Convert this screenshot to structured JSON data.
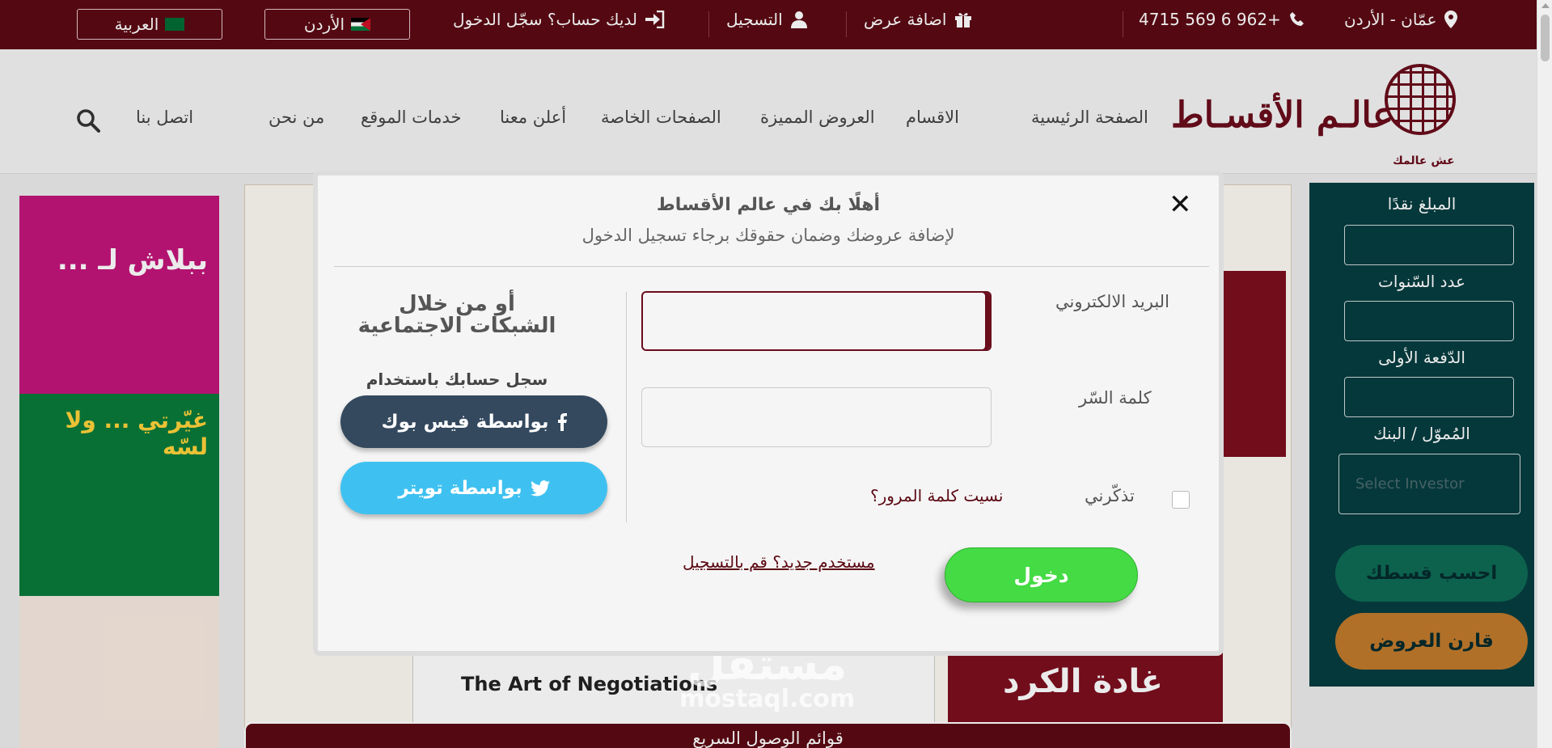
{
  "topbar": {
    "location": "عمّان - الأردن",
    "phone": "4715 569 6 962+",
    "add_offer": "اضافة عرض",
    "register": "التسجيل",
    "login_prompt": "لديك حساب؟ سجّل الدخول",
    "country": "الأردن",
    "language": "العربية"
  },
  "header": {
    "logo_text": "عالـم الأقسـاط",
    "logo_tagline": "عش عالمك",
    "nav": [
      "الصفحة الرئيسية",
      "الاقسام",
      "العروض المميزة",
      "الصفحات الخاصة",
      "أعلن معنا",
      "خدمات الموقع",
      "من نحن",
      "اتصل بنا"
    ]
  },
  "calculator": {
    "cash_amount": "المبلغ نقدًا",
    "years": "عدد السّنوات",
    "down_payment": "الدّفعة الأولى",
    "financier": "المُموّل / البنك",
    "select_placeholder": "Select Investor",
    "calc_button": "احسب قسطك",
    "compare_button": "قارن العروض"
  },
  "background": {
    "course_item": "The Art of Negotiations",
    "book_title": "غادة الكرد",
    "quick_links": "قوائم الوصول السريع",
    "ad1_text": "ببلاش لـ ...",
    "ad2_text": "غيّرتي ... ولا لسّه"
  },
  "modal": {
    "title": "أهلًا بك في عالم الأقساط",
    "subtitle": "لإضافة عروضك وضمان حقوقك برجاء تسجيل الدخول",
    "email_label": "البريد الالكتروني",
    "password_label": "كلمة السّر",
    "remember_label": "تذكّرني",
    "forgot_link": "نسيت كلمة المرور؟",
    "login_button": "دخول",
    "register_link": "مستخدم جديد؟ قم بالتسجيل",
    "social_title": "أو من خلال الشبكات الاجتماعية",
    "social_subtitle": "سجل حسابك باستخدام",
    "facebook_button": "بواسطة فيس بوك",
    "twitter_button": "بواسطة تويتر",
    "email_value": "",
    "password_value": ""
  },
  "watermark": {
    "ar": "مستقل",
    "en": "mostaql.com"
  },
  "icons": {
    "location": "map-marker-icon",
    "phone": "phone-icon",
    "gift": "gift-icon",
    "user": "user-icon",
    "login": "sign-in-icon",
    "search": "search-icon",
    "close": "close-icon",
    "facebook": "facebook-icon",
    "twitter": "twitter-icon"
  },
  "colors": {
    "brand": "#5c0a14",
    "login_green": "#44db44",
    "facebook": "#34495e",
    "twitter": "#3ec1f0",
    "calc_panel": "#063d41"
  }
}
